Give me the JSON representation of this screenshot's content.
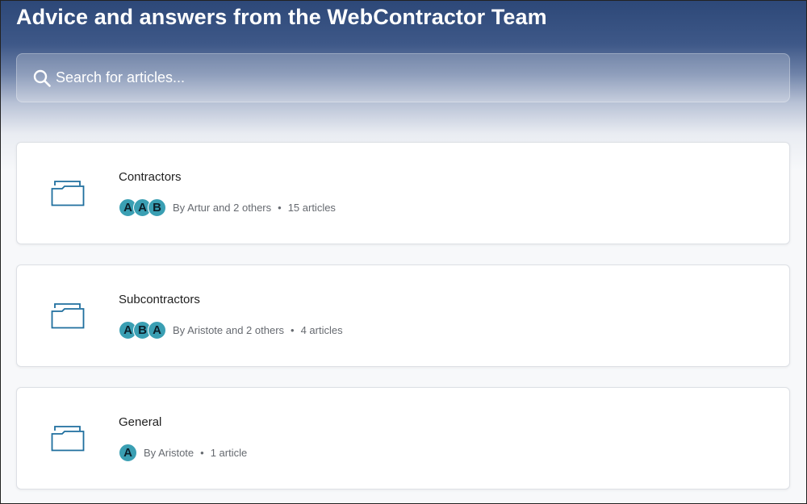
{
  "header": {
    "title": "Advice and answers from the WebContractor Team"
  },
  "search": {
    "placeholder": "Search for articles...",
    "icon": "search-icon"
  },
  "colors": {
    "header_top": "#2d4878",
    "avatar_bg": "#3a9fb3",
    "icon_stroke": "#1f6f9e"
  },
  "collections": [
    {
      "title": "Contractors",
      "icon": "folder-icon",
      "avatars": [
        "A",
        "A",
        "B"
      ],
      "author_text": "By Artur and 2 others",
      "count_text": "15 articles"
    },
    {
      "title": "Subcontractors",
      "icon": "folder-icon",
      "avatars": [
        "A",
        "B",
        "A"
      ],
      "author_text": "By Aristote and 2 others",
      "count_text": "4 articles"
    },
    {
      "title": "General",
      "icon": "folder-icon",
      "avatars": [
        "A"
      ],
      "author_text": "By Aristote",
      "count_text": "1 article"
    }
  ]
}
